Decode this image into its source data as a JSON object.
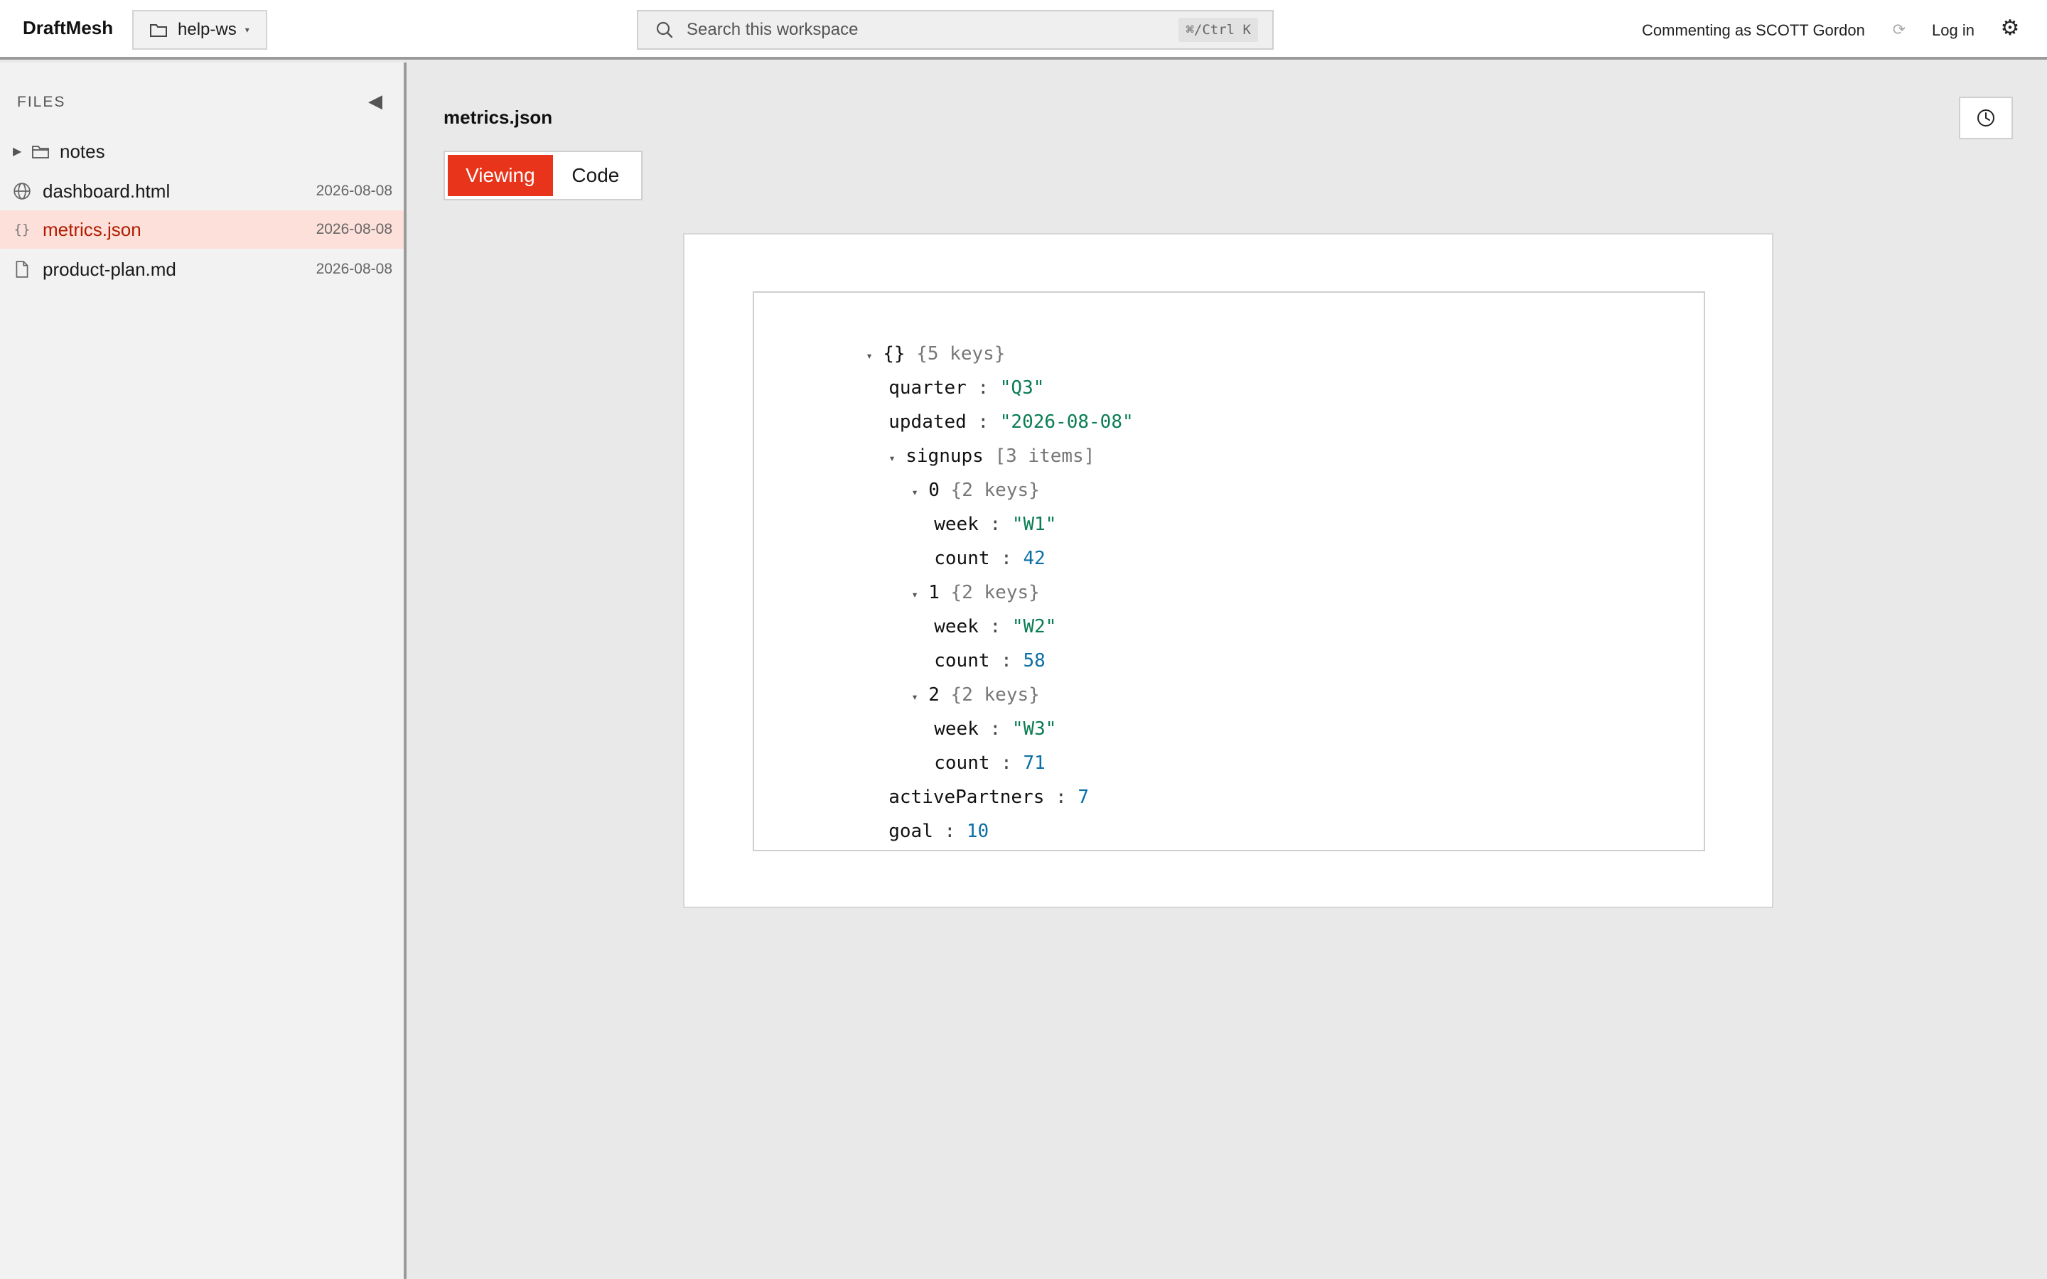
{
  "app": {
    "brand": "DraftMesh",
    "workspace": "help-ws",
    "search_placeholder": "Search this workspace",
    "search_shortcut": "⌘/Ctrl K",
    "commenting_as": "Commenting as SCOTT Gordon",
    "login_label": "Log in"
  },
  "sidebar": {
    "title": "FILES",
    "items": [
      {
        "name": "notes",
        "date": ""
      },
      {
        "name": "dashboard.html",
        "date": "2026-08-08"
      },
      {
        "name": "metrics.json",
        "date": "2026-08-08"
      },
      {
        "name": "product-plan.md",
        "date": "2026-08-08"
      }
    ]
  },
  "document": {
    "title": "metrics.json",
    "modes": {
      "viewing": "Viewing",
      "code": "Code"
    }
  },
  "json_view": {
    "root": {
      "label": "{}",
      "meta": "{5 keys}"
    },
    "quarter": {
      "key": "quarter",
      "value": "\"Q3\""
    },
    "updated": {
      "key": "updated",
      "value": "\"2026-08-08\""
    },
    "signups": {
      "key": "signups",
      "meta": "[3 items]"
    },
    "items": [
      {
        "index": "0",
        "meta": "{2 keys}",
        "week_key": "week",
        "week": "\"W1\"",
        "count_key": "count",
        "count": "42"
      },
      {
        "index": "1",
        "meta": "{2 keys}",
        "week_key": "week",
        "week": "\"W2\"",
        "count_key": "count",
        "count": "58"
      },
      {
        "index": "2",
        "meta": "{2 keys}",
        "week_key": "week",
        "week": "\"W3\"",
        "count_key": "count",
        "count": "71"
      }
    ],
    "activePartners": {
      "key": "activePartners",
      "value": "7"
    },
    "goal": {
      "key": "goal",
      "value": "10"
    }
  },
  "colors": {
    "accent": "#e8341a",
    "active_row_bg": "#fde0da",
    "active_row_text": "#b01c00",
    "json_string": "#0a7d53",
    "json_number": "#0b6fa6"
  }
}
